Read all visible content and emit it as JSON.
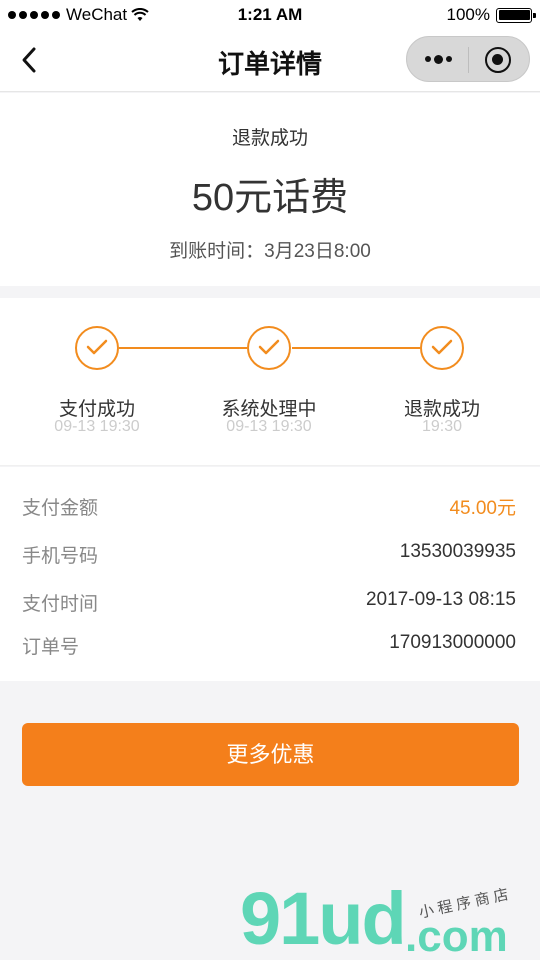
{
  "status_bar": {
    "carrier": "WeChat",
    "time": "1:21 AM",
    "battery": "100%"
  },
  "nav": {
    "title": "订单详情"
  },
  "summary": {
    "status": "退款成功",
    "product": "50元话费",
    "arrival_label": "到账时间：",
    "arrival_time": "3月23日8:00"
  },
  "progress": {
    "color": "#f28c1e",
    "steps": [
      {
        "label": "支付成功",
        "time": "09-13 19:30"
      },
      {
        "label": "系统处理中",
        "time": "09-13 19:30"
      },
      {
        "label": "退款成功",
        "time": "19:30"
      }
    ]
  },
  "details": {
    "rows": [
      {
        "key": "支付金额",
        "value": "45.00元"
      },
      {
        "key": "手机号码",
        "value": "13530039935"
      },
      {
        "key": "支付时间",
        "value": "2017-09-13 08:15"
      },
      {
        "key": "订单号",
        "value": "170913000000"
      }
    ],
    "accent_color": "#f28c1e"
  },
  "promo_button": {
    "label": "更多优惠",
    "color": "#f47f1b"
  },
  "watermark": {
    "main": "91ud",
    "suffix": ".com",
    "tag": "小程序商店"
  }
}
